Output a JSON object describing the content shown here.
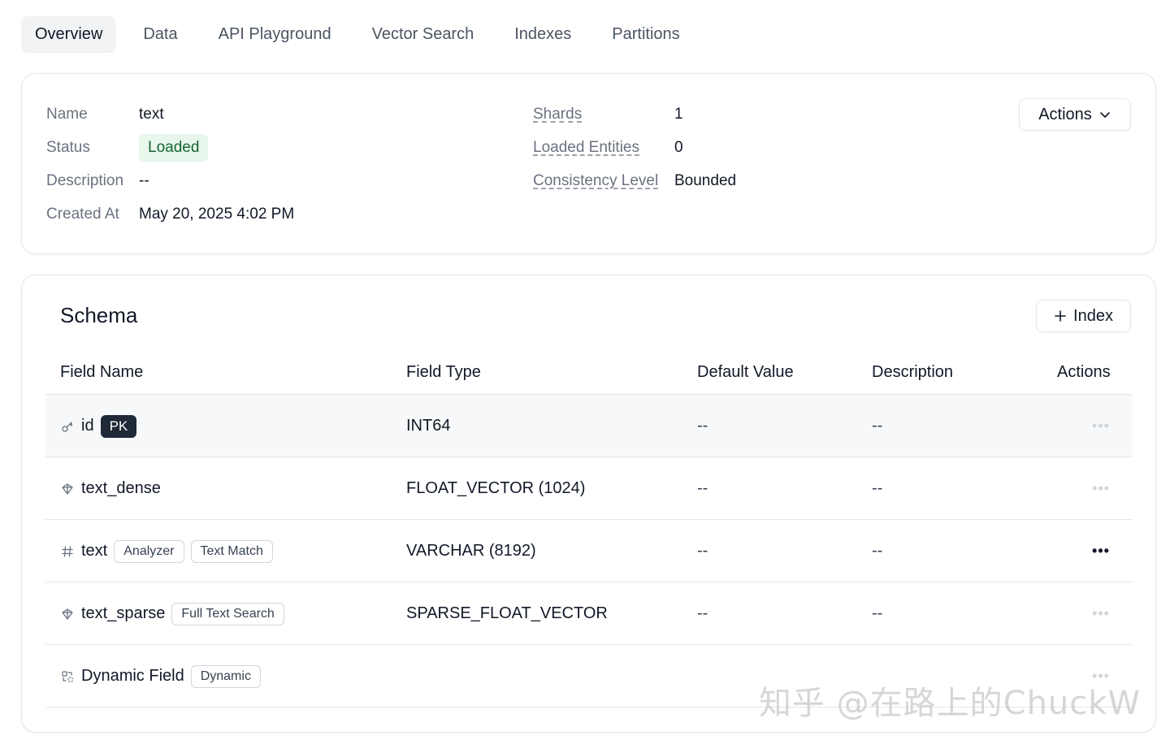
{
  "tabs": [
    {
      "label": "Overview",
      "active": true
    },
    {
      "label": "Data"
    },
    {
      "label": "API Playground"
    },
    {
      "label": "Vector Search"
    },
    {
      "label": "Indexes"
    },
    {
      "label": "Partitions"
    }
  ],
  "info": {
    "name_label": "Name",
    "name_value": "text",
    "status_label": "Status",
    "status_value": "Loaded",
    "description_label": "Description",
    "description_value": "--",
    "created_label": "Created At",
    "created_value": "May 20, 2025 4:02 PM",
    "shards_label": "Shards",
    "shards_value": "1",
    "entities_label": "Loaded Entities",
    "entities_value": "0",
    "consistency_label": "Consistency Level",
    "consistency_value": "Bounded",
    "actions_label": "Actions"
  },
  "schema": {
    "title": "Schema",
    "add_index_label": "Index",
    "columns": [
      "Field Name",
      "Field Type",
      "Default Value",
      "Description",
      "Actions"
    ],
    "rows": [
      {
        "icon": "key-icon",
        "name": "id",
        "tags": [
          "PK"
        ],
        "type": "INT64",
        "default": "--",
        "description": "--",
        "actions": "•••"
      },
      {
        "icon": "vector-icon",
        "name": "text_dense",
        "tags": [],
        "type": "FLOAT_VECTOR (1024)",
        "default": "--",
        "description": "--",
        "actions": "•••"
      },
      {
        "icon": "hash-icon",
        "name": "text",
        "tags": [
          "Analyzer",
          "Text Match"
        ],
        "type": "VARCHAR (8192)",
        "default": "--",
        "description": "--",
        "actions": "•••"
      },
      {
        "icon": "vector-icon",
        "name": "text_sparse",
        "tags": [
          "Full Text Search"
        ],
        "type": "SPARSE_FLOAT_VECTOR",
        "default": "--",
        "description": "--",
        "actions": "•••"
      },
      {
        "icon": "dynamic-field-icon",
        "name": "Dynamic Field",
        "tags": [
          "Dynamic"
        ],
        "type": "",
        "default": "",
        "description": "",
        "actions": "•••"
      }
    ]
  },
  "watermark": "知乎 @在路上的ChuckW"
}
